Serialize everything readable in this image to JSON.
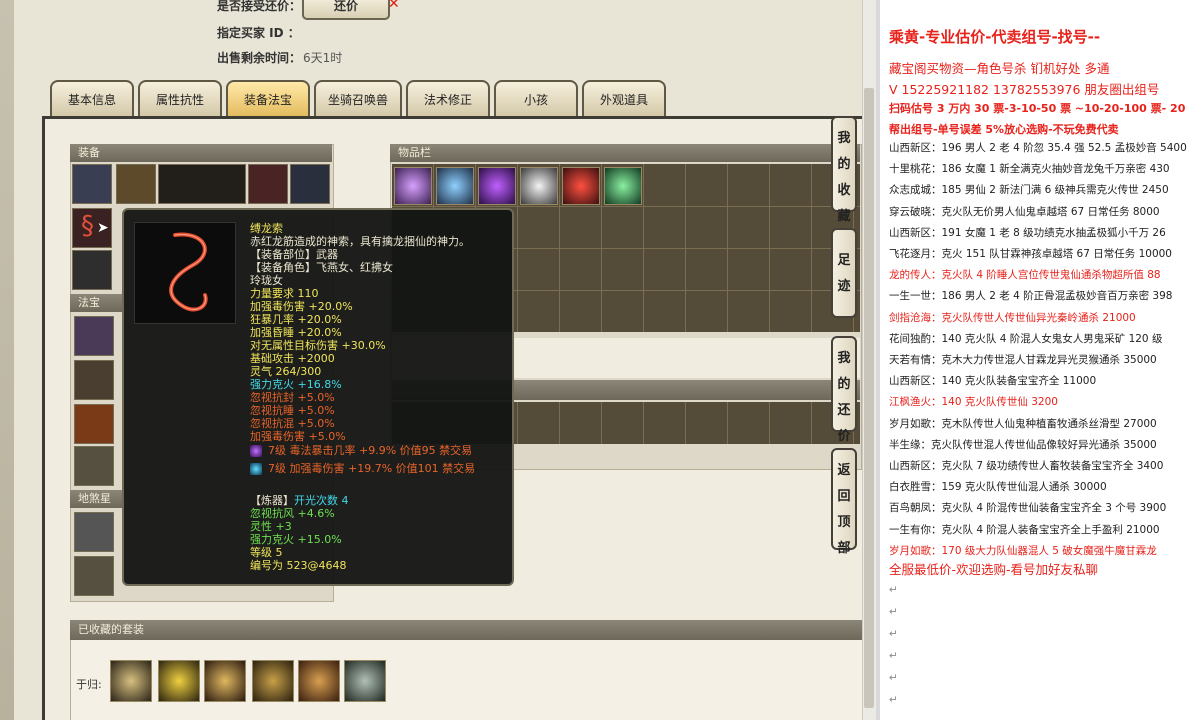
{
  "listing": {
    "accept_offer_label": "是否接受还价：",
    "reply_button": "还价",
    "buyer_id_label": "指定买家 ID ：",
    "remaining_label": "出售剩余时间：",
    "remaining_value": "6天1时"
  },
  "tabs": [
    {
      "label": "基本信息"
    },
    {
      "label": "属性抗性"
    },
    {
      "label": "装备法宝",
      "active": true
    },
    {
      "label": "坐骑召唤兽"
    },
    {
      "label": "法术修正"
    },
    {
      "label": "小孩"
    },
    {
      "label": "外观道具"
    }
  ],
  "sections": {
    "equipment": "装备",
    "inventory": "物品栏",
    "fabao": "法宝",
    "dizhi": "地煞星",
    "collected_sets": "已收藏的套装",
    "yugui_label": "于归:"
  },
  "side_buttons": [
    {
      "label": "我的收藏"
    },
    {
      "label": "足迹"
    },
    {
      "label": "我的还价"
    },
    {
      "label": "返回顶部"
    }
  ],
  "tooltip": {
    "name": "缚龙索",
    "desc": "赤红龙筋造成的神索，具有擒龙捆仙的神力。",
    "slot": "【装备部位】武器",
    "roles_1": "【装备角色】飞燕女、红拂女",
    "roles_2": "玲珑女",
    "lines_yellow": [
      "力量要求 110",
      "加强毒伤害 +20.0%",
      "狂暴几率 +20.0%",
      "加强昏睡 +20.0%",
      "对无属性目标伤害 +30.0%",
      "基础攻击 +2000",
      "灵气 264/300"
    ],
    "line_cyan": "强力克火 +16.8%",
    "lines_orange": [
      "忽视抗封 +5.0%",
      "忽视抗睡 +5.0%",
      "忽视抗混 +5.0%",
      "加强毒伤害 +5.0%"
    ],
    "gem_1": "7级 毒法暴击几率 +9.9% 价值95 禁交易",
    "gem_2": "7级 加强毒伤害 +19.7% 价值101 禁交易",
    "refine_head_label": "【炼器】",
    "refine_head_value": "开光次数 4",
    "refine_lines": [
      "忽视抗风 +4.6%",
      "灵性 +3",
      "强力克火 +15.0%"
    ],
    "level": "等级 5",
    "serial": "编号为 523@4648"
  },
  "doc": {
    "title": "乘黄-专业估价-代卖组号-找号--",
    "line_bank": "藏宝阁买物资—角色号杀 钔机好处 多通",
    "line_contact": "V 15225921182   13782553976 朋友圈出组号",
    "line_price": "扫码估号 3 万内 30 票-3-10-50 票 ~10-20-100 票- 20 以上",
    "line_sell": "帮出组号-单号误差 5%放心选购-不玩免费代卖",
    "entries": [
      {
        "text": "山西新区：196 男人 2 老 4 阶忽 35.4 强 52.5 孟极妙音 5400",
        "red": false
      },
      {
        "text": "十里桃花：186 女魔 1 新全满克火抽妙音龙兔千万亲密 430",
        "red": false
      },
      {
        "text": "众志成城：185 男仙 2 新法门满 6 级神兵需克火传世 2450",
        "red": false
      },
      {
        "text": "穿云破晓：克火队无价男人仙鬼卓越塔 67 日常任务 8000",
        "red": false
      },
      {
        "text": "山西新区：191 女魔 1 老 8 级功绩克水抽孟极狐小千万 26",
        "red": false
      },
      {
        "text": "飞花逐月：克火 151 队甘霖神孩卓越塔 67 日常任务 10000",
        "red": false
      },
      {
        "text": "龙的传人：克火队 4 阶睡人宫位传世鬼仙通杀物超所值 88",
        "red": true
      },
      {
        "text": "一生一世：186 男人 2 老 4 阶正骨混孟极妙音百万亲密 398",
        "red": false
      },
      {
        "text": "剑指沧海：克火队传世人传世仙异光秦岭通杀 21000",
        "red": true
      },
      {
        "text": "花间独酌：140 克火队 4 阶混人女鬼女人男鬼采矿 120 级",
        "red": false
      },
      {
        "text": "天若有情：克木大力传世混人甘霖龙异光灵猴通杀 35000",
        "red": false
      },
      {
        "text": "山西新区：140 克火队装备宝宝齐全 11000",
        "red": false
      },
      {
        "text": "江枫渔火：140 克火队传世仙 3200",
        "red": true
      },
      {
        "text": "岁月如歌：克木队传世人仙鬼种植畜牧通杀丝滑型 27000",
        "red": false
      },
      {
        "text": "半生缘：克火队传世混人传世仙品像较好异光通杀 35000",
        "red": false
      },
      {
        "text": "山西新区：克火队 7 级功绩传世人畜牧装备宝宝齐全 3400",
        "red": false
      },
      {
        "text": "白衣胜雪：159 克火队传世仙混人通杀 30000",
        "red": false
      },
      {
        "text": "百鸟朝凤：克火队 4 阶混传世仙装备宝宝齐全 3 个号 3900",
        "red": false
      },
      {
        "text": "一生有你：克火队 4 阶混人装备宝宝齐全上手盈利 21000",
        "red": false
      },
      {
        "text": "岁月如歌：170 级大力队仙器混人 5 破女魔强牛魔甘霖龙",
        "red": true
      }
    ],
    "footer": "全服最低价-欢迎选购-看号加好友私聊"
  },
  "colors": {
    "accent_red": "#e8221b",
    "tooltip_yellow": "#efe45a",
    "tooltip_cyan": "#42d8e8",
    "tooltip_orange": "#e8632a"
  }
}
